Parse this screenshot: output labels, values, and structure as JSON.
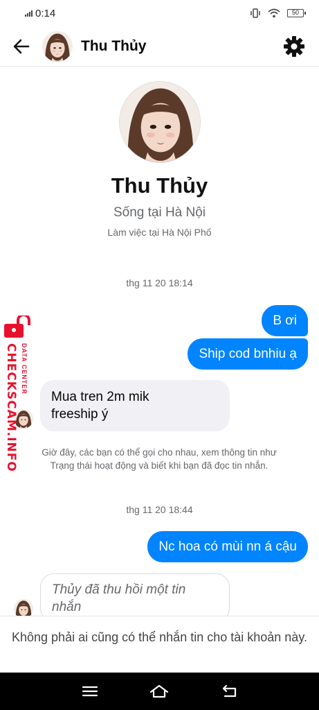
{
  "status_bar": {
    "time": "0:14",
    "battery": "50"
  },
  "header": {
    "name": "Thu Thủy"
  },
  "profile": {
    "name": "Thu Thủy",
    "location": "Sống tại Hà Nội",
    "work": "Làm việc tại Hà Nội Phố"
  },
  "conversation": {
    "timestamp_1": "thg 11 20 18:14",
    "msg_out_1": "B ơi",
    "msg_out_2": "Ship cod bnhiu ạ",
    "msg_in_1_line1": "Mua tren 2m mik",
    "msg_in_1_line2": "freeship ý",
    "info_note": "Giờ đây, các bạn có thể gọi cho nhau, xem thông tin như Trạng thái hoạt động và biết khi bạn đã đọc tin nhắn.",
    "timestamp_2": "thg 11 20 18:44",
    "msg_out_3": "Nc hoa có mùi nn á cậu",
    "recalled_line1": "Thủy đã thu hồi một tin",
    "recalled_line2": "nhắn"
  },
  "footer": {
    "note": "Không phải ai cũng có thể nhắn tin cho tài khoản này."
  },
  "watermark": {
    "brand": "CHECKSCAM.INFO",
    "tagline": "DATA CENTER"
  },
  "colors": {
    "outgoing_bubble": "#0084ff",
    "incoming_bubble": "#f0f0f5",
    "watermark": "#e8112d"
  }
}
